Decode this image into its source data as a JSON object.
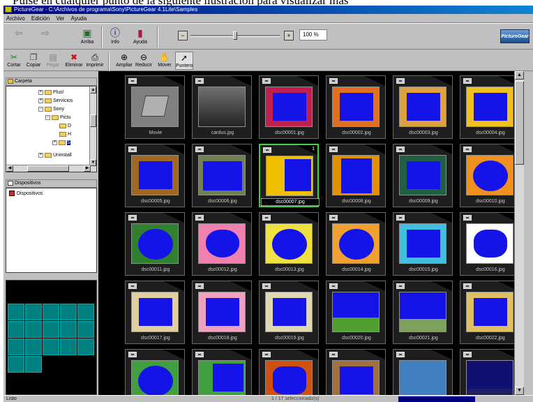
{
  "caption": {
    "text": "Pulse en cualquier punto de la siguiente ilustración para visualizar más"
  },
  "window": {
    "title": "PictureGear - C:\\Archivos de programa\\Sony\\PictureGear 4.1Lite\\Samples"
  },
  "menu": [
    "Archivo",
    "Edición",
    "Ver",
    "Ayuda"
  ],
  "toolbar1": {
    "back_label": "",
    "forward_label": "",
    "up_label": "Arriba",
    "info_label": "Info",
    "help_label": "Ayuda",
    "zoom_value": "100 %",
    "zoom_fraction": 0.5,
    "logo": "PictureGear"
  },
  "toolbar2": {
    "cut": "Cortar",
    "copy": "Copiar",
    "paste": "Pegar",
    "delete": "Eliminar",
    "print": "Imprimir",
    "zoom_in": "Ampliar",
    "zoom_out": "Reducir",
    "move": "Mover",
    "pointer": "Puntero"
  },
  "left_pane": {
    "folder_header": "Carpeta",
    "tree": [
      "Plus!",
      "Servicios",
      "Sony",
      "Pictu",
      "D",
      "H",
      "S",
      "Uninstall"
    ],
    "devices_header": "Dispositivos",
    "devices": [
      "Dispositivos"
    ]
  },
  "thumbnails": [
    {
      "name": "Movie",
      "style": "movie"
    },
    {
      "name": "cardus.jpg",
      "style": "photo"
    },
    {
      "name": "dsc00001.jpg",
      "style": "curtain"
    },
    {
      "name": "dsc00002.jpg",
      "style": "orange"
    },
    {
      "name": "dsc00003.jpg",
      "style": "colorful"
    },
    {
      "name": "dsc00004.jpg",
      "style": "yellow"
    },
    {
      "name": "dsc00005.jpg",
      "style": "wood"
    },
    {
      "name": "dsc00006.jpg",
      "style": "book"
    },
    {
      "name": "dsc00007.jpg",
      "style": "flowers",
      "number": "1"
    },
    {
      "name": "dsc00008.jpg",
      "style": "sunflower"
    },
    {
      "name": "dsc00009.jpg",
      "style": "leaves"
    },
    {
      "name": "dsc00010.jpg",
      "style": "ovalorange"
    },
    {
      "name": "dsc00011.jpg",
      "style": "wreath"
    },
    {
      "name": "dsc00012.jpg",
      "style": "heart"
    },
    {
      "name": "dsc00013.jpg",
      "style": "ovalyellow"
    },
    {
      "name": "dsc00014.jpg",
      "style": "ovalorange2"
    },
    {
      "name": "dsc00015.jpg",
      "style": "cyan"
    },
    {
      "name": "dsc00016.jpg",
      "style": "splash"
    },
    {
      "name": "dsc00017.jpg",
      "style": "kids"
    },
    {
      "name": "dsc00018.jpg",
      "style": "pink"
    },
    {
      "name": "dsc00019.jpg",
      "style": "beige"
    },
    {
      "name": "dsc00020.jpg",
      "style": "scene"
    },
    {
      "name": "dsc00021.jpg",
      "style": "scene2"
    },
    {
      "name": "dsc00022.jpg",
      "style": "frame"
    },
    {
      "name": "",
      "style": "circle"
    },
    {
      "name": "",
      "style": "snowman"
    },
    {
      "name": "",
      "style": "star"
    },
    {
      "name": "",
      "style": "brown"
    },
    {
      "name": "",
      "style": "fish"
    },
    {
      "name": "",
      "style": "space"
    }
  ],
  "selected_index": 8,
  "status": {
    "left": "Listo",
    "middle": "1 / 17 seleccionado(s)"
  }
}
